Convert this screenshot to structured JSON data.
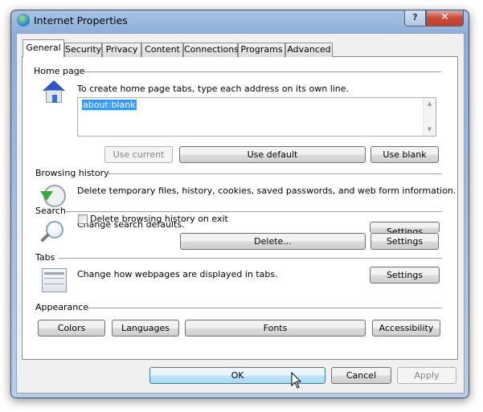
{
  "window": {
    "title": "Internet Properties",
    "help": "?",
    "close": "✕"
  },
  "tabs": [
    "General",
    "Security",
    "Privacy",
    "Content",
    "Connections",
    "Programs",
    "Advanced"
  ],
  "home": {
    "label": "Home page",
    "hint": "To create home page tabs, type each address on its own line.",
    "value": "about:blank",
    "use_current": "Use current",
    "use_default": "Use default",
    "use_blank": "Use blank"
  },
  "history": {
    "label": "Browsing history",
    "text": "Delete temporary files, history, cookies, saved passwords, and web form information.",
    "checkbox": "Delete browsing history on exit",
    "delete": "Delete...",
    "settings": "Settings"
  },
  "search": {
    "label": "Search",
    "text": "Change search defaults.",
    "settings": "Settings"
  },
  "tabsec": {
    "label": "Tabs",
    "text": "Change how webpages are displayed in tabs.",
    "settings": "Settings"
  },
  "appearance": {
    "label": "Appearance",
    "colors": "Colors",
    "languages": "Languages",
    "fonts": "Fonts",
    "accessibility": "Accessibility"
  },
  "footer": {
    "ok": "OK",
    "cancel": "Cancel",
    "apply": "Apply"
  }
}
